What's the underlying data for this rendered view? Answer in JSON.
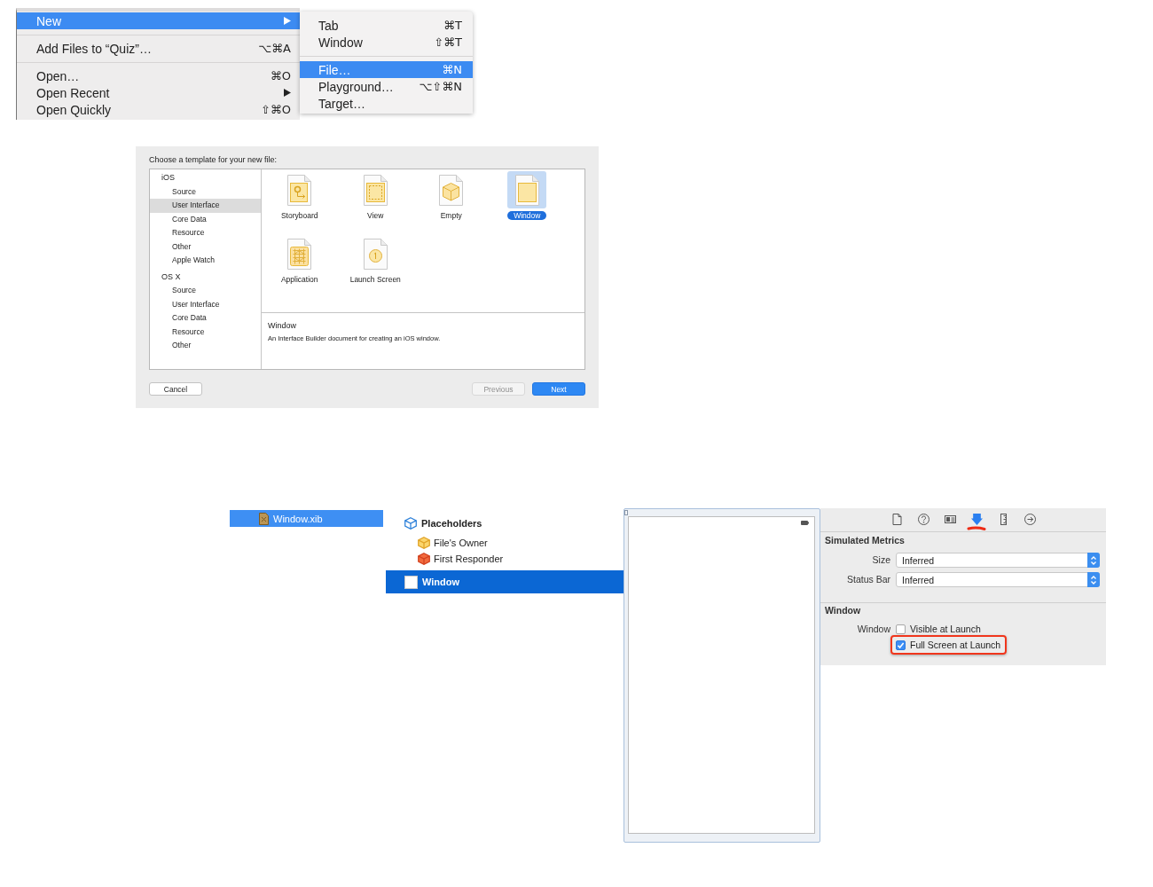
{
  "menu": {
    "sections": [
      {
        "items": [
          {
            "label": "New",
            "submenu": true,
            "selected": true
          }
        ]
      },
      {
        "items": [
          {
            "label": "Add Files to “Quiz”…",
            "shortcut": "⌥⌘A",
            "submenu": false,
            "selected": false
          }
        ]
      },
      {
        "items": [
          {
            "label": "Open…",
            "shortcut": "⌘O",
            "submenu": false,
            "selected": false
          },
          {
            "label": "Open Recent",
            "submenu": true,
            "selected": false
          },
          {
            "label": "Open Quickly",
            "shortcut": "⇧⌘O",
            "submenu": false,
            "selected": false
          }
        ]
      }
    ]
  },
  "submenu": {
    "sections": [
      {
        "items": [
          {
            "label": "Tab",
            "shortcut": "⌘T",
            "selected": false
          },
          {
            "label": "Window",
            "shortcut": "⇧⌘T",
            "selected": false
          }
        ]
      },
      {
        "items": [
          {
            "label": "File…",
            "shortcut": "⌘N",
            "selected": true
          },
          {
            "label": "Playground…",
            "shortcut": "⌥⇧⌘N",
            "selected": false
          },
          {
            "label": "Target…",
            "selected": false
          }
        ]
      }
    ]
  },
  "template_dialog": {
    "prompt": "Choose a template for your new file:",
    "categories": [
      {
        "label": "iOS",
        "selected": false,
        "children": [
          {
            "label": "Source",
            "selected": false
          },
          {
            "label": "User Interface",
            "selected": true
          },
          {
            "label": "Core Data",
            "selected": false
          },
          {
            "label": "Resource",
            "selected": false
          },
          {
            "label": "Other",
            "selected": false
          },
          {
            "label": "Apple Watch",
            "selected": false
          }
        ]
      },
      {
        "label": "OS X",
        "selected": false,
        "children": [
          {
            "label": "Source",
            "selected": false
          },
          {
            "label": "User Interface",
            "selected": false
          },
          {
            "label": "Core Data",
            "selected": false
          },
          {
            "label": "Resource",
            "selected": false
          },
          {
            "label": "Other",
            "selected": false
          }
        ]
      }
    ],
    "templates": [
      {
        "kind": "storyboard",
        "label": "Storyboard",
        "selected": false
      },
      {
        "kind": "view",
        "label": "View",
        "selected": false
      },
      {
        "kind": "empty",
        "label": "Empty",
        "selected": false
      },
      {
        "kind": "window",
        "label": "Window",
        "selected": true
      },
      {
        "kind": "application",
        "label": "Application",
        "selected": false
      },
      {
        "kind": "launch",
        "label": "Launch Screen",
        "selected": false
      }
    ],
    "description": {
      "title": "Window",
      "text": "An Interface Builder document for creating an iOS window."
    },
    "buttons": [
      {
        "kind": "cancel",
        "label": "Cancel",
        "disabled": false
      },
      {
        "kind": "previous",
        "label": "Previous",
        "disabled": true
      },
      {
        "kind": "next",
        "label": "Next",
        "disabled": false
      }
    ]
  },
  "file_navigator": {
    "items": [
      {
        "label": "Window.xib",
        "selected": true
      }
    ]
  },
  "outline": {
    "items": [
      {
        "kind": "placeholders",
        "label": "Placeholders",
        "selected": false,
        "children": [
          {
            "kind": "owner",
            "label": "File's Owner",
            "selected": false
          },
          {
            "kind": "responder",
            "label": "First Responder",
            "selected": false
          }
        ]
      },
      {
        "kind": "window",
        "label": "Window",
        "selected": true
      }
    ]
  },
  "inspector": {
    "tabs": [
      {
        "kind": "file",
        "selected": false,
        "highlighted": false
      },
      {
        "kind": "help",
        "selected": false,
        "highlighted": false
      },
      {
        "kind": "identity",
        "selected": false,
        "highlighted": false
      },
      {
        "kind": "attributes",
        "selected": true,
        "highlighted": true
      },
      {
        "kind": "size",
        "selected": false,
        "highlighted": false
      },
      {
        "kind": "connections",
        "selected": false,
        "highlighted": false
      }
    ],
    "sections": [
      {
        "title": "Simulated Metrics",
        "fields": [
          {
            "kind": "popup",
            "label": "Size",
            "value": "Inferred"
          },
          {
            "kind": "popup",
            "label": "Status Bar",
            "value": "Inferred"
          }
        ]
      },
      {
        "title": "Window",
        "fields": [
          {
            "kind": "checkboxes",
            "label": "Window",
            "options": [
              {
                "label": "Visible at Launch",
                "checked": false,
                "highlighted": false
              },
              {
                "label": "Full Screen at Launch",
                "checked": true,
                "highlighted": true
              }
            ]
          }
        ]
      }
    ]
  }
}
